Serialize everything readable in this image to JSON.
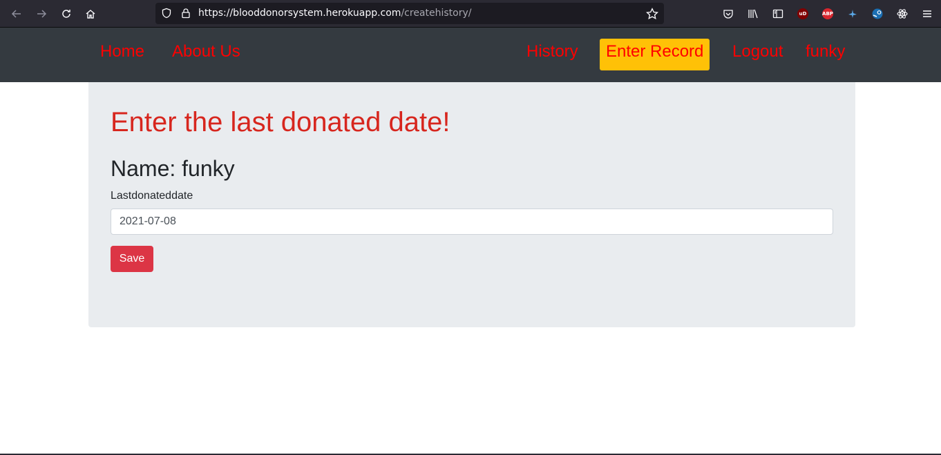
{
  "browser": {
    "url_host": "https://blooddonorsystem.herokuapp.com",
    "url_path": "/createhistory/",
    "extensions": [
      {
        "name": "ublock-origin",
        "text": "uD",
        "color": "#800000"
      },
      {
        "name": "adblock-plus",
        "text": "ABP",
        "color": "#d8262e"
      }
    ]
  },
  "nav": {
    "home": "Home",
    "about": "About Us",
    "history": "History",
    "enter_record": "Enter Record",
    "logout": "Logout",
    "user": "funky"
  },
  "page": {
    "title": "Enter the last donated date!",
    "name_line": "Name: funky",
    "field_label": "Lastdonateddate",
    "field_value": "2021-07-08",
    "save_label": "Save"
  },
  "colors": {
    "nav_bg": "#343a40",
    "nav_link": "#ff0000",
    "active_bg": "#ffc107",
    "title": "#d7261e",
    "button": "#dc3545"
  }
}
